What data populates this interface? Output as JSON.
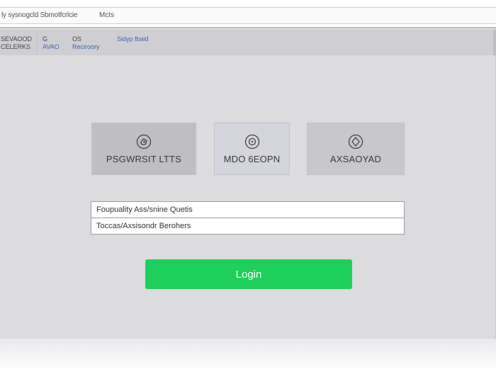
{
  "window": {
    "title": "ly sysnogcld Sbmotfcrlcie",
    "menu_label": "Mcts"
  },
  "toolbar": {
    "items": [
      {
        "top": "SEVAOOD",
        "bottom": "CELERKS"
      },
      {
        "top": "G",
        "bottom": "AVAO"
      },
      {
        "top": "OS",
        "bottom": "Reciroory"
      },
      {
        "top": "",
        "bottom": "Sidyp fbaid"
      }
    ]
  },
  "tiles": [
    {
      "label": "PSGWRSIT LTTS",
      "icon": "tag-icon"
    },
    {
      "label": "MDO 6EOPN",
      "icon": "target-icon"
    },
    {
      "label": "AXSAOYAD",
      "icon": "diamond-icon"
    }
  ],
  "fields": {
    "first": {
      "value": "Foupuality Ass/snine Quetis"
    },
    "second": {
      "value": "Toccas/Axsisondr Berohers"
    }
  },
  "login": {
    "label": "Login",
    "color": "#1fcf5c"
  },
  "colors": {
    "background": "#dcdcdf",
    "toolbar": "#cfcfd3",
    "link": "#3d63b8"
  }
}
